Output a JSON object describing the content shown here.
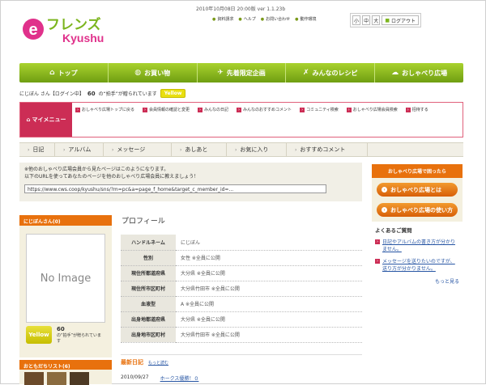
{
  "header": {
    "logo_text": "eフレンズ Kyushu",
    "version": "2010年10月08日 20:00版 ver 1.1.23b",
    "links": [
      "資料請求",
      "ヘルプ",
      "お問い合わせ",
      "動作環境"
    ],
    "font_sizes": [
      "小",
      "中",
      "大"
    ],
    "logout": "ログアウト"
  },
  "nav": {
    "items": [
      {
        "label": "トップ",
        "icon": "home-icon"
      },
      {
        "label": "お買い物",
        "icon": "shopping-icon"
      },
      {
        "label": "先着限定企画",
        "icon": "runner-icon"
      },
      {
        "label": "みんなのレシピ",
        "icon": "fork-knife-icon"
      },
      {
        "label": "おしゃべり広場",
        "icon": "chat-icon"
      }
    ]
  },
  "user": {
    "name": "にじぼん さん【ログイン中】",
    "count": "60",
    "count_suffix": "の“拍手”が贈られています",
    "badge": "Yellow"
  },
  "mymenu": {
    "label": "マイメニュー",
    "links": [
      "おしゃべり広場トップに戻る",
      "会員情報の確認と変更",
      "みんなの日記",
      "みんなのおすすめコメント",
      "コミュニティ検索",
      "おしゃべり広場会員検索",
      "招待する"
    ]
  },
  "subnav": {
    "items": [
      "日記",
      "アルバム",
      "メッセージ",
      "あしあと",
      "お気に入り",
      "おすすめコメント"
    ]
  },
  "notice": {
    "line1": "※他のおしゃべり広場会員から見たページはこのようになります。",
    "line2": "以下のURLを使ってあなたのページを他のおしゃべり広場会員に教えましょう！",
    "url": "https://www.cws.coop/kyushu/sns/?m=pc&a=page_f_home&target_c_member_id=..."
  },
  "sidebar_right": {
    "head": "おしゃべり広場で困ったら",
    "buttons": [
      "おしゃべり広場とは",
      "おしゃべり広場の使い方"
    ],
    "faq_title": "よくあるご質問",
    "faq": [
      "日記やアルバムの書き方が分かりません。",
      "メッセージを送りたいのですが、送り方が分かりません。"
    ],
    "more": "もっと見る"
  },
  "sidebar_left": {
    "head": "にじぼんさん(0)",
    "no_image": "No Image",
    "badge": "Yellow",
    "count": "60",
    "caption": "の“拍手”が贈られています",
    "friends_head": "おともだちリスト(6)"
  },
  "profile": {
    "title": "プロフィール",
    "rows": [
      {
        "key": "ハンドルネーム",
        "value": "にじぼん"
      },
      {
        "key": "性別",
        "value": "女性 ※全員に公開"
      },
      {
        "key": "現住所都道府県",
        "value": "大分県 ※全員に公開"
      },
      {
        "key": "現住所市区町村",
        "value": "大分県竹田市 ※全員に公開"
      },
      {
        "key": "血液型",
        "value": "A ※全員に公開"
      },
      {
        "key": "出身地都道府県",
        "value": "大分県 ※全員に公開"
      },
      {
        "key": "出身地市区町村",
        "value": "大分県竹田市 ※全員に公開"
      }
    ]
  },
  "recent": {
    "title": "最新日記",
    "more": "もっと読む",
    "date": "2010/09/27",
    "entry": "ホークス優勝！０"
  }
}
